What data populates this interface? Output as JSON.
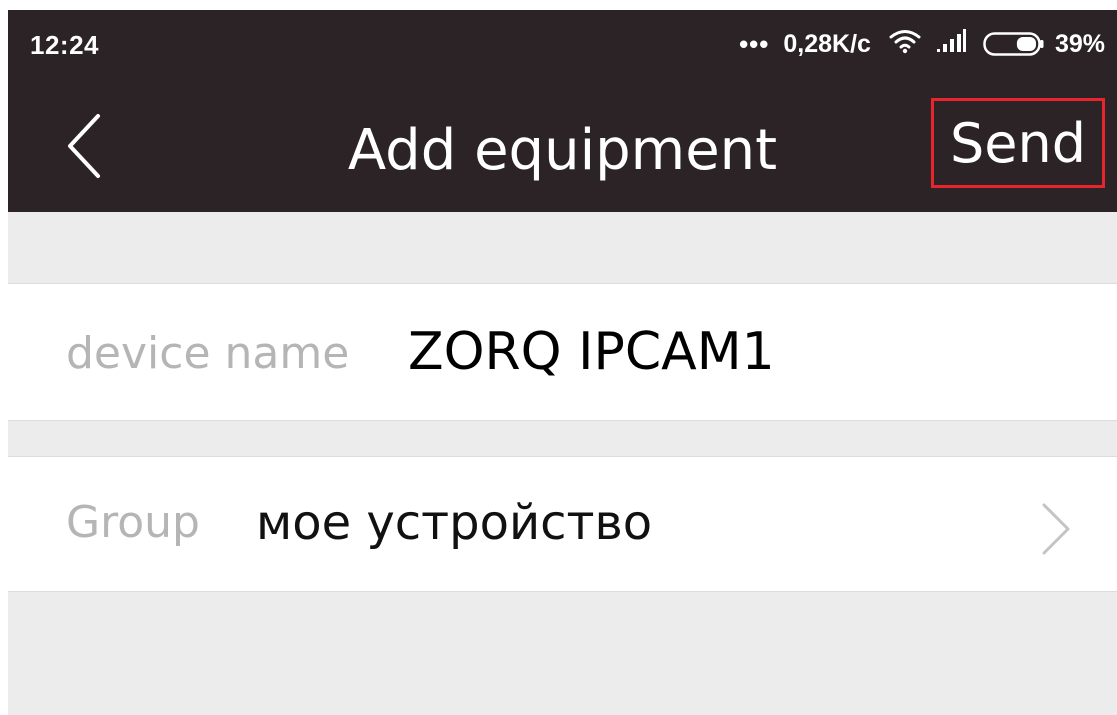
{
  "status_bar": {
    "time": "12:24",
    "dots": "•••",
    "speed": "0,28K/c",
    "wifi_icon": "wifi-icon",
    "signal_icon": "signal-icon",
    "battery_icon": "battery-icon",
    "battery_percent": "39%",
    "battery_level": 0.39
  },
  "app_bar": {
    "back_icon": "chevron-left-icon",
    "title": "Add equipment",
    "send_label": "Send",
    "highlight_color": "#e8242e"
  },
  "form": {
    "device_name": {
      "label": "device name",
      "value": "ZORQ IPCAM1"
    },
    "group": {
      "label": "Group",
      "value": "мое устройство",
      "chevron_icon": "chevron-right-icon"
    }
  },
  "colors": {
    "bar_background": "#2b2326",
    "page_background": "#ececec",
    "label_gray": "#b5b5b5"
  }
}
